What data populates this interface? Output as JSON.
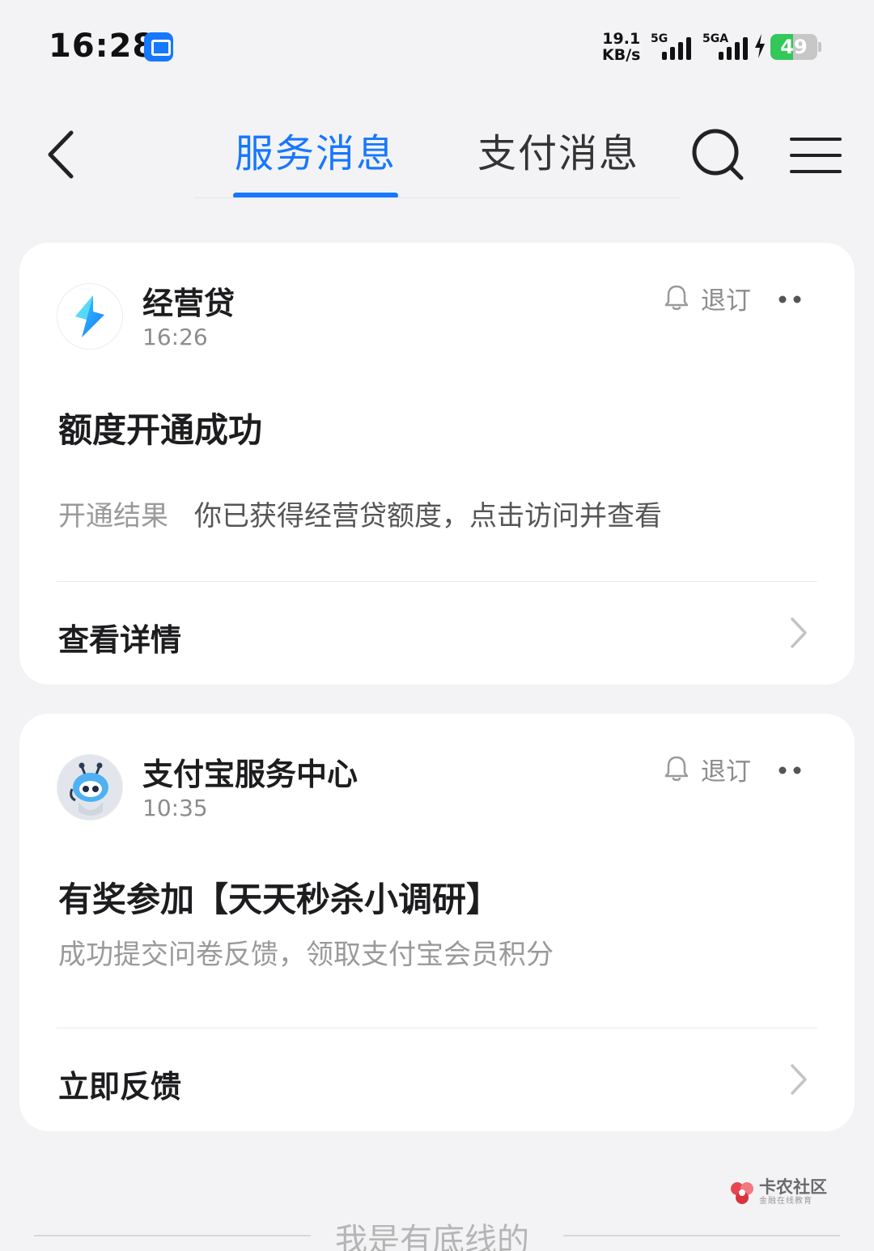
{
  "status_bar": {
    "time": "16:28",
    "net_speed_value": "19.1",
    "net_speed_unit": "KB/s",
    "network_1": "5G",
    "network_2": "5GA",
    "battery_level": "49",
    "battery_fraction": 0.49
  },
  "nav": {
    "tabs": [
      {
        "label": "服务消息",
        "active": true
      },
      {
        "label": "支付消息",
        "active": false
      }
    ],
    "accent_color": "#1677ff"
  },
  "messages": [
    {
      "sender": "经营贷",
      "time": "16:26",
      "unsubscribe_label": "退订",
      "title": "额度开通成功",
      "detail_key": "开通结果",
      "detail_value": "你已获得经营贷额度，点击访问并查看",
      "action_label": "查看详情",
      "avatar_icon": "jingyingdai-logo-icon"
    },
    {
      "sender": "支付宝服务中心",
      "time": "10:35",
      "unsubscribe_label": "退订",
      "title": "有奖参加【天天秒杀小调研】",
      "detail_value": "成功提交问卷反馈，领取支付宝会员积分",
      "action_label": "立即反馈",
      "avatar_icon": "robot-mascot-icon"
    }
  ],
  "footer": {
    "end_text": "我是有底线的"
  },
  "watermark": {
    "title": "卡农社区",
    "subtitle": "金融在线教育"
  }
}
